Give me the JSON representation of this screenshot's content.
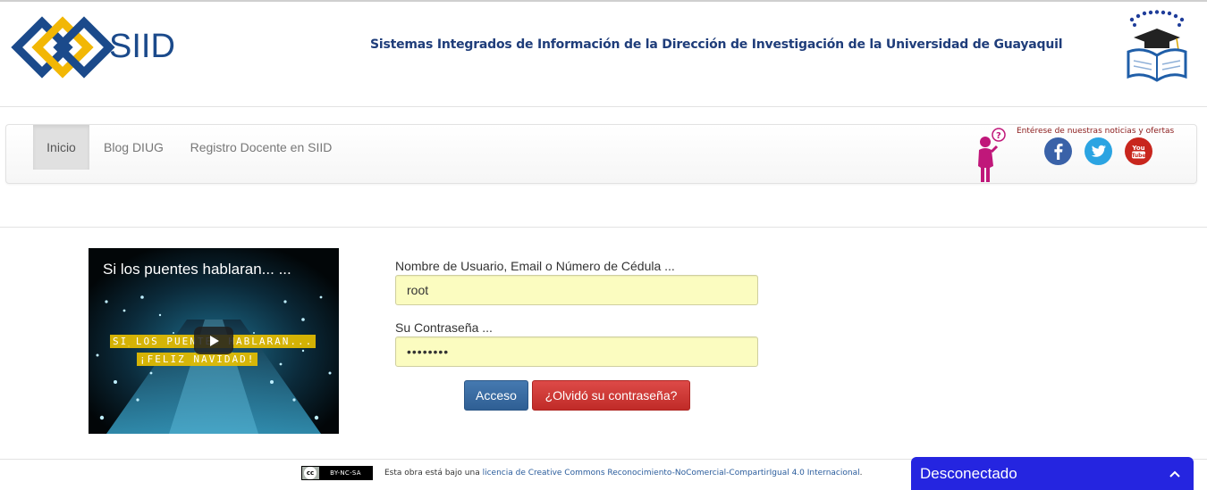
{
  "header": {
    "logo_text": "SIID",
    "title": "Sistemas Integrados de Información de la Dirección de Investigación de la Universidad de Guayaquil"
  },
  "nav": {
    "items": [
      {
        "label": "Inicio",
        "active": true
      },
      {
        "label": "Blog DIUG",
        "active": false
      },
      {
        "label": "Registro Docente en SIID",
        "active": false
      }
    ],
    "social_text": "Entérese de nuestras noticias y ofertas",
    "social_icons": [
      "facebook-icon",
      "twitter-icon",
      "youtube-icon"
    ],
    "youtube_badge": "You Tube"
  },
  "video": {
    "title": "Si los puentes hablaran... ...",
    "caption_line1": "SI LOS PUENTES HABLARAN...",
    "caption_line2": "¡FELIZ NAVIDAD!"
  },
  "form": {
    "username_label": "Nombre de Usuario, Email o Número de Cédula ...",
    "username_value": "root",
    "password_label": "Su Contraseña ...",
    "password_value": "••••••••",
    "login_button": "Acceso",
    "forgot_button": "¿Olvidó su contraseña?"
  },
  "footer": {
    "cc_badge": "BY-NC-SA",
    "cc_symbol": "cc",
    "text_prefix": "Esta obra está bajo una ",
    "link_text": "licencia de Creative Commons Reconocimiento-NoComercial-CompartirIgual 4.0 Internacional",
    "text_suffix": "."
  },
  "chat": {
    "status": "Desconectado"
  },
  "colors": {
    "brand_blue": "#1b4a8b",
    "brand_yellow": "#f2b705",
    "primary_button": "#3a6ca3",
    "danger_button": "#d43f3a",
    "input_autofill": "#fbfcc0",
    "chat_bg": "#2525e0"
  }
}
